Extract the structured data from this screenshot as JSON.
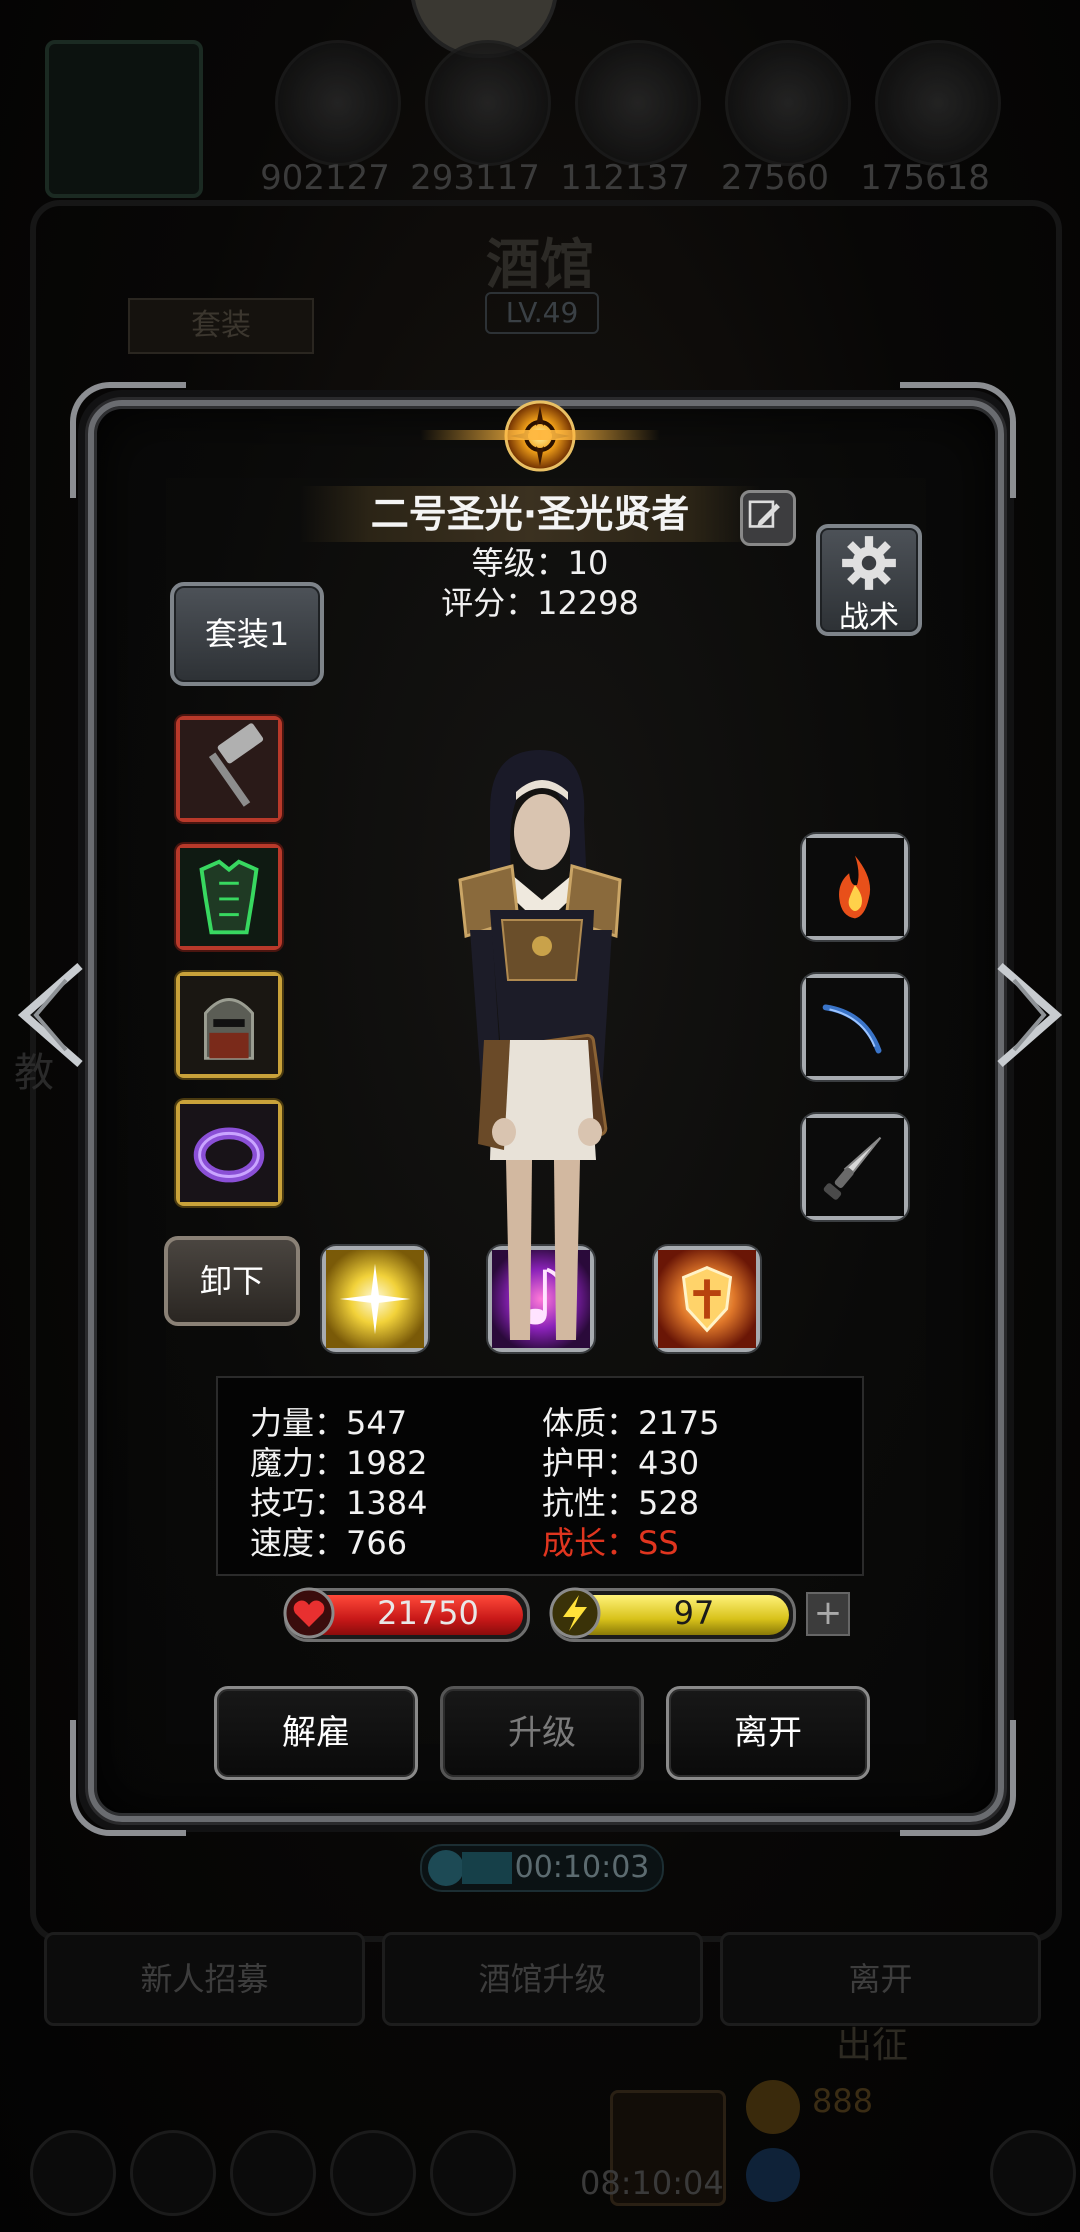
{
  "background": {
    "resources": [
      "902127",
      "293117",
      "112137",
      "27560",
      "175618"
    ],
    "title": "酒馆",
    "level_badge": "LV.49",
    "tab_label": "套装",
    "timer": "00:10:03",
    "buttons": [
      "新人招募",
      "酒馆升级",
      "离开"
    ],
    "expedition_label": "出征",
    "coin_count": "888",
    "bottom_time": "08:10:04",
    "side_char": "教"
  },
  "hero": {
    "name": "二号圣光·圣光贤者",
    "level_text": "等级：10",
    "score_text": "评分：12298",
    "set_button": "套装1",
    "tactic_button": "战术",
    "unequip_button": "卸下",
    "equipment_left": [
      {
        "icon": "hammer-icon",
        "quality": "red"
      },
      {
        "icon": "green-armor-icon",
        "quality": "red"
      },
      {
        "icon": "helmet-icon",
        "quality": "gold"
      },
      {
        "icon": "purple-ring-icon",
        "quality": "gold"
      }
    ],
    "equipment_right": [
      {
        "icon": "fire-rune-icon"
      },
      {
        "icon": "blue-feather-icon"
      },
      {
        "icon": "dagger-icon"
      }
    ],
    "skills": [
      {
        "icon": "holy-light-skill-icon"
      },
      {
        "icon": "music-note-skill-icon"
      },
      {
        "icon": "holy-shield-skill-icon"
      }
    ]
  },
  "stats": {
    "strength": "力量：547",
    "constitution": "体质：2175",
    "magic": "魔力：1982",
    "armor": "护甲：430",
    "skill": "技巧：1384",
    "resistance": "抗性：528",
    "speed": "速度：766",
    "growth": "成长：SS"
  },
  "bars": {
    "hp": "21750",
    "energy": "97",
    "plus": "+"
  },
  "actions": {
    "dismiss": "解雇",
    "upgrade": "升级",
    "leave": "离开"
  },
  "colors": {
    "growth_red": "#e0351f",
    "hp_red": "#c81818",
    "energy_yellow": "#d8c21a"
  }
}
